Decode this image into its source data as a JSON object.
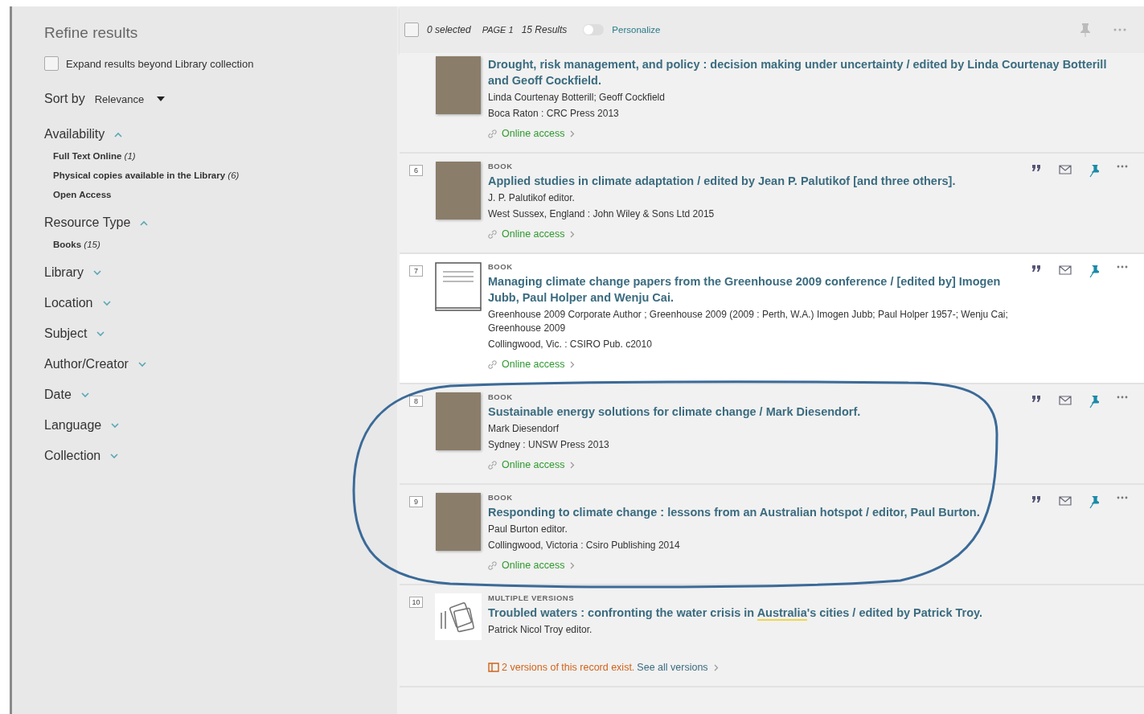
{
  "sidebar": {
    "title": "Refine results",
    "expand": {
      "label": "Expand results beyond Library collection",
      "checked": false
    },
    "sort": {
      "label": "Sort by",
      "value": "Relevance"
    },
    "facets": [
      {
        "title": "Availability",
        "expanded": true,
        "items": [
          {
            "label": "Full Text Online",
            "count": "(1)"
          },
          {
            "label": "Physical copies available in the Library",
            "count": "(6)"
          },
          {
            "label": "Open Access"
          }
        ]
      },
      {
        "title": "Resource Type",
        "expanded": true,
        "items": [
          {
            "label": "Books",
            "count": "(15)"
          }
        ]
      },
      {
        "title": "Library",
        "expanded": false
      },
      {
        "title": "Location",
        "expanded": false
      },
      {
        "title": "Subject",
        "expanded": false
      },
      {
        "title": "Author/Creator",
        "expanded": false
      },
      {
        "title": "Date",
        "expanded": false
      },
      {
        "title": "Language",
        "expanded": false
      },
      {
        "title": "Collection",
        "expanded": false
      }
    ]
  },
  "toolbar": {
    "select_all": {
      "checked": false
    },
    "selected": "0 selected",
    "page": "PAGE 1",
    "results": "15 Results",
    "personalize": {
      "label": "Personalize",
      "on": false
    }
  },
  "results": [
    {
      "kind": "cover",
      "hovered": false,
      "actions": false,
      "title": "Drought, risk management, and policy : decision making under uncertainty / edited by Linda Courtenay Botterill and Geoff Cockfield.",
      "lines": [
        "Linda Courtenay Botterill; Geoff Cockfield",
        "Boca Raton : CRC Press 2013"
      ],
      "online": "Online access"
    },
    {
      "kind": "cover",
      "number": "6",
      "type": "BOOK",
      "hovered": false,
      "actions": true,
      "title": "Applied studies in climate adaptation / edited by Jean P. Palutikof [and three others].",
      "lines": [
        "J. P. Palutikof editor.",
        "West Sussex, England : John Wiley & Sons Ltd 2015"
      ],
      "online": "Online access"
    },
    {
      "kind": "generic",
      "number": "7",
      "type": "BOOK",
      "hovered": true,
      "actions": true,
      "title": "Managing climate change papers from the Greenhouse 2009 conference / [edited by] Imogen Jubb, Paul Holper and Wenju Cai.",
      "lines": [
        "Greenhouse 2009 Corporate Author ; Greenhouse 2009 (2009 : Perth, W.A.) Imogen Jubb; Paul Holper 1957-; Wenju Cai; Greenhouse 2009",
        "Collingwood, Vic. : CSIRO Pub. c2010"
      ],
      "online": "Online access"
    },
    {
      "kind": "cover",
      "number": "8",
      "type": "BOOK",
      "hovered": false,
      "actions": true,
      "title": "Sustainable energy solutions for climate change / Mark Diesendorf.",
      "lines": [
        "Mark Diesendorf",
        "Sydney : UNSW Press 2013"
      ],
      "online": "Online access"
    },
    {
      "kind": "cover",
      "number": "9",
      "type": "BOOK",
      "hovered": false,
      "actions": true,
      "title": "Responding to climate change : lessons from an Australian hotspot / editor, Paul Burton.",
      "lines": [
        "Paul Burton editor.",
        "Collingwood, Victoria : Csiro Publishing 2014"
      ],
      "online": "Online access"
    },
    {
      "kind": "versions",
      "number": "10",
      "type": "MULTIPLE VERSIONS",
      "hovered": false,
      "actions": false,
      "title_parts": [
        {
          "text": "Troubled waters : confronting the water crisis in ",
          "highlight": false
        },
        {
          "text": "Australia",
          "highlight": true
        },
        {
          "text": "'s cities / edited by Patrick Troy.",
          "highlight": false
        }
      ],
      "lines": [
        "Patrick Nicol Troy editor."
      ],
      "versions": {
        "text": "2 versions of this record exist.",
        "link": "See all versions"
      }
    }
  ]
}
